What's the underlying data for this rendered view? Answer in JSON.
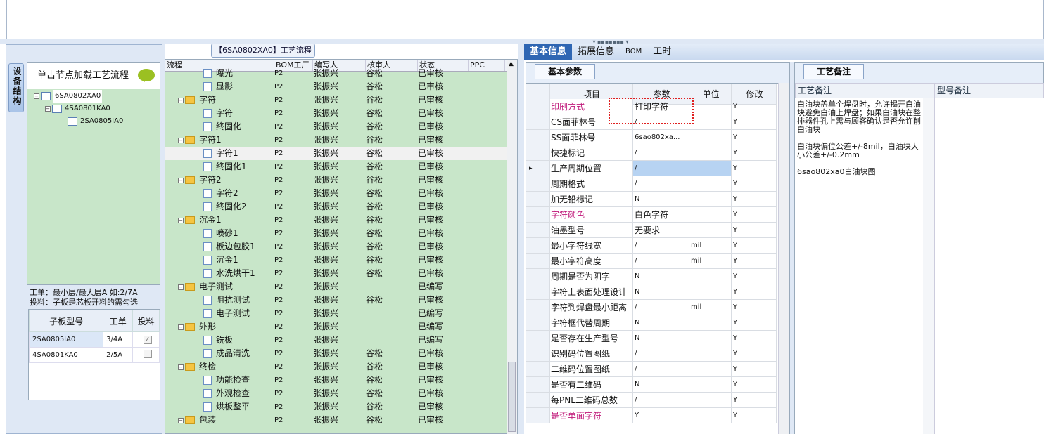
{
  "left": {
    "vtab": "设备结构",
    "tree_hint": "单击节点加载工艺流程",
    "tree": [
      "6SA0802XA0",
      "4SA0801KA0",
      "2SA0805IA0"
    ],
    "info1": "工单：最小层/最大层A 如:2/7A",
    "info2": "投料：子板是芯板开料的需勾选",
    "sub_headers": [
      "子板型号",
      "工单",
      "投料"
    ],
    "sub_rows": [
      {
        "model": "2SA0805IA0",
        "order": "3/4A",
        "checked": "✓"
      },
      {
        "model": "4SA0801KA0",
        "order": "2/5A",
        "checked": ""
      }
    ]
  },
  "flow": {
    "title": "【6SA0802XA0】工艺流程",
    "headers": [
      "流程",
      "BOM工厂",
      "编写人",
      "核审人",
      "状态",
      "PPC"
    ],
    "rows": [
      {
        "name": "曝光",
        "lvl": 2,
        "bom": "P2",
        "writer": "张振兴",
        "reviewer": "谷松",
        "status": "已审核"
      },
      {
        "name": "显影",
        "lvl": 2,
        "bom": "P2",
        "writer": "张振兴",
        "reviewer": "谷松",
        "status": "已审核"
      },
      {
        "name": "字符",
        "lvl": 1,
        "bom": "P2",
        "writer": "张振兴",
        "reviewer": "谷松",
        "status": "已审核"
      },
      {
        "name": "字符",
        "lvl": 2,
        "bom": "P2",
        "writer": "张振兴",
        "reviewer": "谷松",
        "status": "已审核"
      },
      {
        "name": "终固化",
        "lvl": 2,
        "bom": "P2",
        "writer": "张振兴",
        "reviewer": "谷松",
        "status": "已审核"
      },
      {
        "name": "字符1",
        "lvl": 1,
        "bom": "P2",
        "writer": "张振兴",
        "reviewer": "谷松",
        "status": "已审核"
      },
      {
        "name": "字符1",
        "lvl": 2,
        "bom": "P2",
        "writer": "张振兴",
        "reviewer": "谷松",
        "status": "已审核",
        "sel": true
      },
      {
        "name": "终固化1",
        "lvl": 2,
        "bom": "P2",
        "writer": "张振兴",
        "reviewer": "谷松",
        "status": "已审核"
      },
      {
        "name": "字符2",
        "lvl": 1,
        "bom": "P2",
        "writer": "张振兴",
        "reviewer": "谷松",
        "status": "已审核"
      },
      {
        "name": "字符2",
        "lvl": 2,
        "bom": "P2",
        "writer": "张振兴",
        "reviewer": "谷松",
        "status": "已审核"
      },
      {
        "name": "终固化2",
        "lvl": 2,
        "bom": "P2",
        "writer": "张振兴",
        "reviewer": "谷松",
        "status": "已审核"
      },
      {
        "name": "沉金1",
        "lvl": 1,
        "bom": "P2",
        "writer": "张振兴",
        "reviewer": "谷松",
        "status": "已审核"
      },
      {
        "name": "喷砂1",
        "lvl": 2,
        "bom": "P2",
        "writer": "张振兴",
        "reviewer": "谷松",
        "status": "已审核"
      },
      {
        "name": "板边包胶1",
        "lvl": 2,
        "bom": "P2",
        "writer": "张振兴",
        "reviewer": "谷松",
        "status": "已审核"
      },
      {
        "name": "沉金1",
        "lvl": 2,
        "bom": "P2",
        "writer": "张振兴",
        "reviewer": "谷松",
        "status": "已审核"
      },
      {
        "name": "水洗烘干1",
        "lvl": 2,
        "bom": "P2",
        "writer": "张振兴",
        "reviewer": "谷松",
        "status": "已审核"
      },
      {
        "name": "电子测试",
        "lvl": 1,
        "bom": "P2",
        "writer": "张振兴",
        "reviewer": "",
        "status": "已编写"
      },
      {
        "name": "阻抗测试",
        "lvl": 2,
        "bom": "P2",
        "writer": "张振兴",
        "reviewer": "谷松",
        "status": "已审核"
      },
      {
        "name": "电子测试",
        "lvl": 2,
        "bom": "P2",
        "writer": "张振兴",
        "reviewer": "",
        "status": "已编写"
      },
      {
        "name": "外形",
        "lvl": 1,
        "bom": "P2",
        "writer": "张振兴",
        "reviewer": "",
        "status": "已编写"
      },
      {
        "name": "铣板",
        "lvl": 2,
        "bom": "P2",
        "writer": "张振兴",
        "reviewer": "",
        "status": "已编写"
      },
      {
        "name": "成品清洗",
        "lvl": 2,
        "bom": "P2",
        "writer": "张振兴",
        "reviewer": "谷松",
        "status": "已审核"
      },
      {
        "name": "终检",
        "lvl": 1,
        "bom": "P2",
        "writer": "张振兴",
        "reviewer": "谷松",
        "status": "已审核"
      },
      {
        "name": "功能检查",
        "lvl": 2,
        "bom": "P2",
        "writer": "张振兴",
        "reviewer": "谷松",
        "status": "已审核"
      },
      {
        "name": "外观检查",
        "lvl": 2,
        "bom": "P2",
        "writer": "张振兴",
        "reviewer": "谷松",
        "status": "已审核"
      },
      {
        "name": "烘板整平",
        "lvl": 2,
        "bom": "P2",
        "writer": "张振兴",
        "reviewer": "谷松",
        "status": "已审核"
      },
      {
        "name": "包装",
        "lvl": 1,
        "bom": "P2",
        "writer": "张振兴",
        "reviewer": "谷松",
        "status": "已审核"
      }
    ]
  },
  "tabs": [
    "基本信息",
    "拓展信息",
    "BOM",
    "工时"
  ],
  "params": {
    "tab": "基本参数",
    "headers": [
      "项目",
      "参数",
      "单位",
      "修改"
    ],
    "rows": [
      {
        "item": "印刷方式",
        "value": "打印字符",
        "unit": "",
        "mod": "Y",
        "pink": true
      },
      {
        "item": "CS面菲林号",
        "value": "/",
        "unit": "",
        "mod": "Y"
      },
      {
        "item": "SS面菲林号",
        "value": "6sao802xa...",
        "unit": "",
        "mod": "Y"
      },
      {
        "item": "快捷标记",
        "value": "/",
        "unit": "",
        "mod": "Y"
      },
      {
        "item": "生产周期位置",
        "value": "/",
        "unit": "",
        "mod": "Y",
        "current": true
      },
      {
        "item": "周期格式",
        "value": "/",
        "unit": "",
        "mod": "Y"
      },
      {
        "item": "加无铅标记",
        "value": "N",
        "unit": "",
        "mod": "Y"
      },
      {
        "item": "字符颜色",
        "value": "白色字符",
        "unit": "",
        "mod": "Y",
        "pink": true
      },
      {
        "item": "油墨型号",
        "value": "无要求",
        "unit": "",
        "mod": "Y"
      },
      {
        "item": "最小字符线宽",
        "value": "/",
        "unit": "mil",
        "mod": "Y"
      },
      {
        "item": "最小字符高度",
        "value": "/",
        "unit": "mil",
        "mod": "Y"
      },
      {
        "item": "周期是否为阴字",
        "value": "N",
        "unit": "",
        "mod": "Y"
      },
      {
        "item": "字符上表面处理设计",
        "value": "N",
        "unit": "",
        "mod": "Y"
      },
      {
        "item": "字符到焊盘最小距离",
        "value": "/",
        "unit": "mil",
        "mod": "Y"
      },
      {
        "item": "字符框代替周期",
        "value": "N",
        "unit": "",
        "mod": "Y"
      },
      {
        "item": "是否存在生产型号",
        "value": "N",
        "unit": "",
        "mod": "Y"
      },
      {
        "item": "识别码位置图纸",
        "value": "/",
        "unit": "",
        "mod": "Y"
      },
      {
        "item": "二维码位置图纸",
        "value": "/",
        "unit": "",
        "mod": "Y"
      },
      {
        "item": "是否有二维码",
        "value": "N",
        "unit": "",
        "mod": "Y"
      },
      {
        "item": "每PNL二维码总数",
        "value": "/",
        "unit": "",
        "mod": "Y"
      },
      {
        "item": "是否单面字符",
        "value": "Y",
        "unit": "",
        "mod": "Y",
        "pink": true
      }
    ]
  },
  "notes": {
    "tab": "工艺备注",
    "h1": "工艺备注",
    "h2": "型号备注",
    "p1": "白油块盖单个焊盘时，允许揭开白油块避免白油上焊盘；如果白油块在整排器件孔上需与顾客确认是否允许削白油块",
    "p2": "白油块偏位公差+/-8mil，白油块大小公差+/-0.2mm",
    "p3": "6sao802xa0白油块图"
  }
}
